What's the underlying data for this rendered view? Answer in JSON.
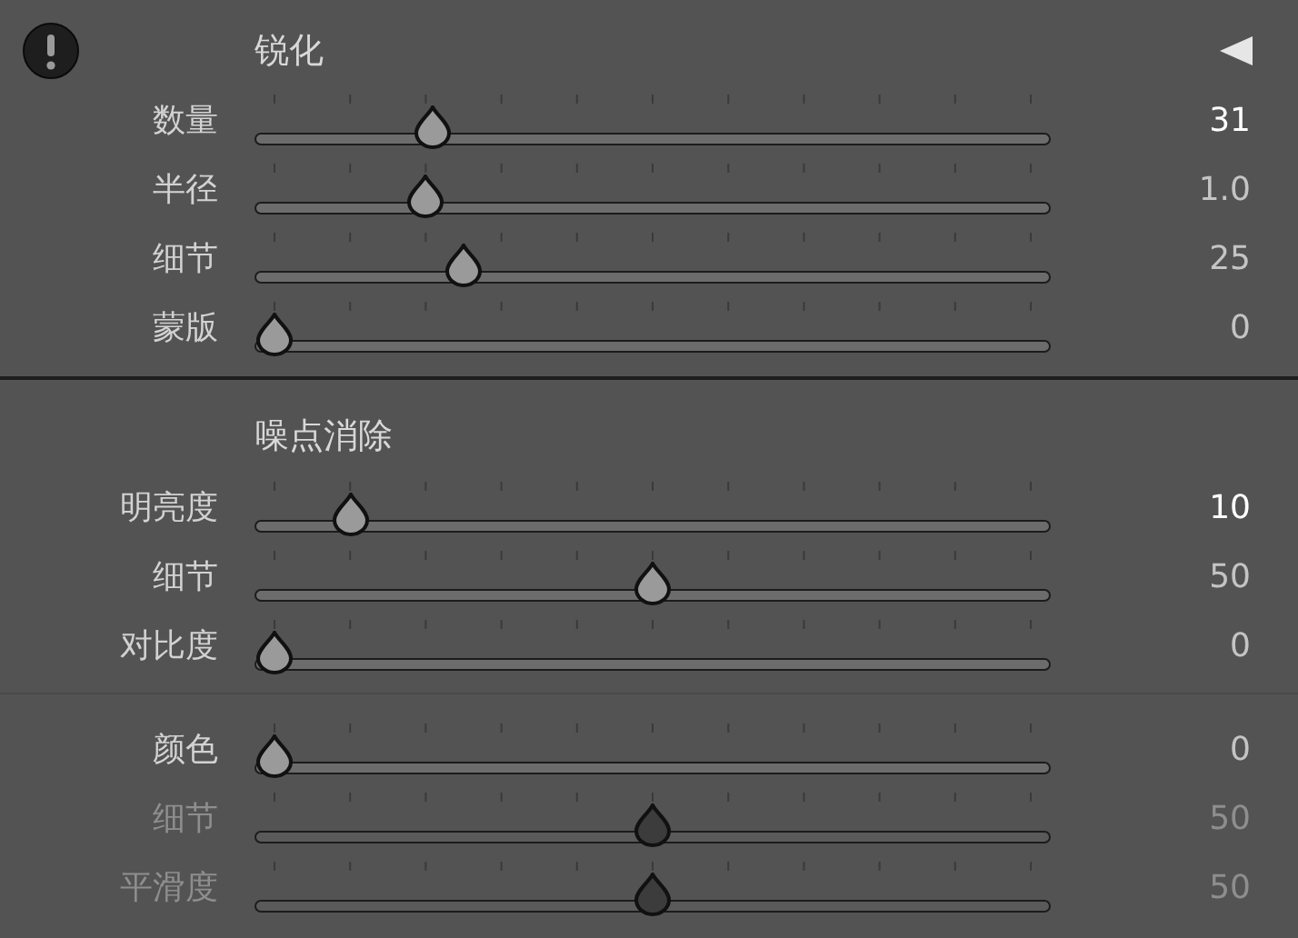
{
  "sections": [
    {
      "title": "锐化",
      "warning": true,
      "collapsible": true,
      "groups": [
        [
          {
            "label": "数量",
            "level": 0.21,
            "value": "31",
            "emphasized": true,
            "disabled": false
          },
          {
            "label": "半径",
            "level": 0.2,
            "value": "1.0",
            "emphasized": false,
            "disabled": false
          },
          {
            "label": "细节",
            "level": 0.25,
            "value": "25",
            "emphasized": false,
            "disabled": false
          },
          {
            "label": "蒙版",
            "level": 0,
            "value": "0",
            "emphasized": false,
            "disabled": false
          }
        ]
      ]
    },
    {
      "title": "噪点消除",
      "warning": false,
      "collapsible": false,
      "groups": [
        [
          {
            "label": "明亮度",
            "level": 0.1,
            "value": "10",
            "emphasized": true,
            "disabled": false
          },
          {
            "label": "细节",
            "level": 0.5,
            "value": "50",
            "emphasized": false,
            "disabled": false
          },
          {
            "label": "对比度",
            "level": 0,
            "value": "0",
            "emphasized": false,
            "disabled": false
          }
        ],
        [
          {
            "label": "颜色",
            "level": 0,
            "value": "0",
            "emphasized": false,
            "disabled": false
          },
          {
            "label": "细节",
            "level": 0.5,
            "value": "50",
            "emphasized": false,
            "disabled": true
          },
          {
            "label": "平滑度",
            "level": 0.5,
            "value": "50",
            "emphasized": false,
            "disabled": true
          }
        ]
      ]
    }
  ]
}
